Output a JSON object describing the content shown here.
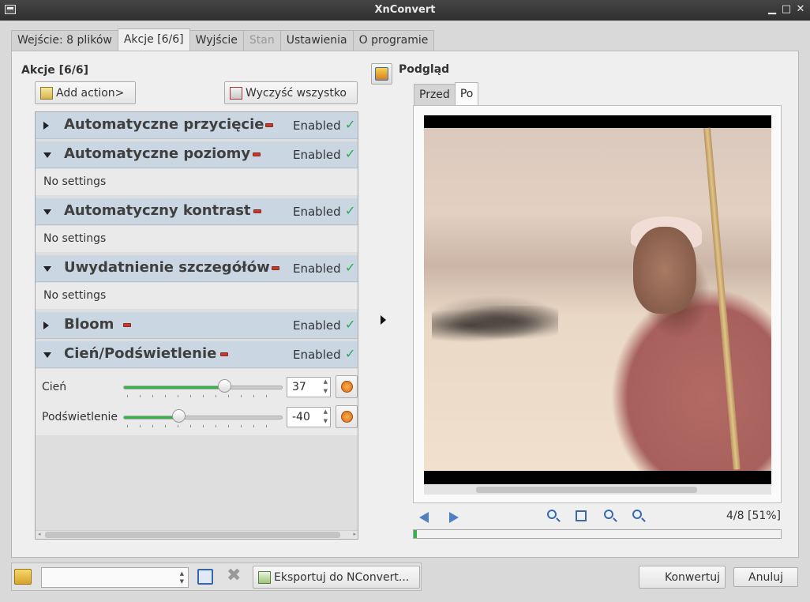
{
  "window": {
    "title": "XnConvert"
  },
  "tabs": [
    {
      "label": "Wejście: 8 plików"
    },
    {
      "label": "Akcje [6/6]"
    },
    {
      "label": "Wyjście"
    },
    {
      "label": "Stan"
    },
    {
      "label": "Ustawienia"
    },
    {
      "label": "O programie"
    }
  ],
  "actions": {
    "title": "Akcje [6/6]",
    "add_label": "Add action>",
    "clear_label": "Wyczyść wszystko",
    "items": [
      {
        "name": "Automatyczne przycięcie",
        "enabled_label": "Enabled",
        "enabled": true,
        "expanded": false
      },
      {
        "name": "Automatyczne poziomy",
        "enabled_label": "Enabled",
        "enabled": true,
        "expanded": true,
        "body": "No settings"
      },
      {
        "name": "Automatyczny kontrast",
        "enabled_label": "Enabled",
        "enabled": true,
        "expanded": true,
        "body": "No settings"
      },
      {
        "name": "Uwydatnienie szczegółów",
        "enabled_label": "Enabled",
        "enabled": true,
        "expanded": true,
        "body": "No settings"
      },
      {
        "name": "Bloom",
        "enabled_label": "Enabled",
        "enabled": true,
        "expanded": false
      },
      {
        "name": "Cień/Podświetlenie",
        "enabled_label": "Enabled",
        "enabled": true,
        "expanded": true
      }
    ],
    "sliders": [
      {
        "label": "Cień",
        "value": "37",
        "fraction": 0.64
      },
      {
        "label": "Podświetlenie",
        "value": "-40",
        "fraction": 0.35
      }
    ]
  },
  "preview": {
    "title": "Podgląd",
    "tabs": [
      {
        "label": "Przed"
      },
      {
        "label": "Po"
      }
    ],
    "zoom_status": "4/8 [51%]",
    "progress_fraction": 0.007
  },
  "bottom": {
    "export_label": "Eksportuj do NConvert...",
    "convert_label": "Konwertuj",
    "cancel_label": "Anuluj"
  },
  "colors": {
    "accent_green": "#35b34a",
    "header_blue": "#cad6e2"
  }
}
